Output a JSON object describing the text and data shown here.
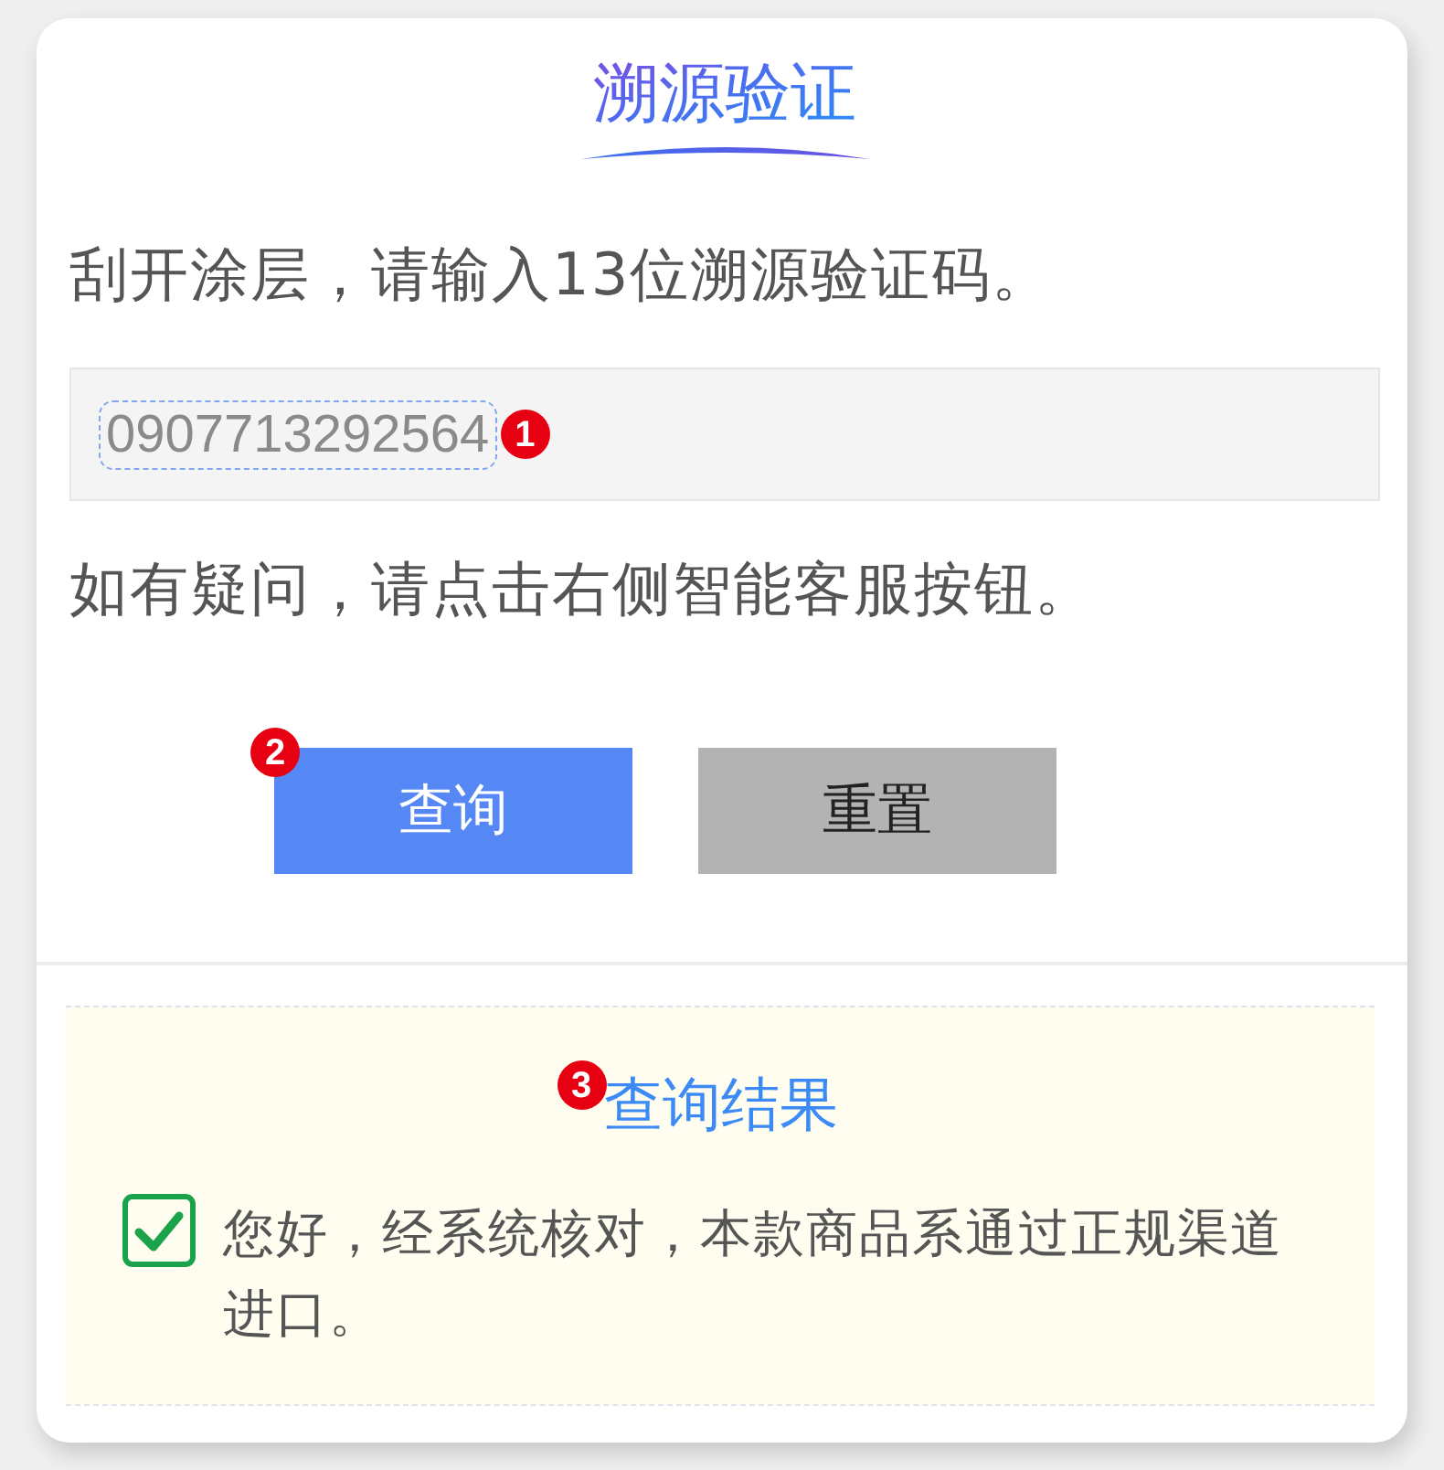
{
  "header": {
    "title": "溯源验证"
  },
  "instruction": "刮开涂层，请输入13位溯源验证码。",
  "code_field": {
    "value": "0907713292564",
    "highlighted": true,
    "badge": "1"
  },
  "help_text": "如有疑问，请点击右侧智能客服按钮。",
  "buttons": [
    {
      "label": "查询",
      "kind": "primary",
      "badge": "2"
    },
    {
      "label": "重置",
      "kind": "secondary"
    }
  ],
  "result": {
    "title": "查询结果",
    "badge": "3",
    "verified": true,
    "message": "您好，经系统核对，本款商品系通过正规渠道进口。"
  }
}
